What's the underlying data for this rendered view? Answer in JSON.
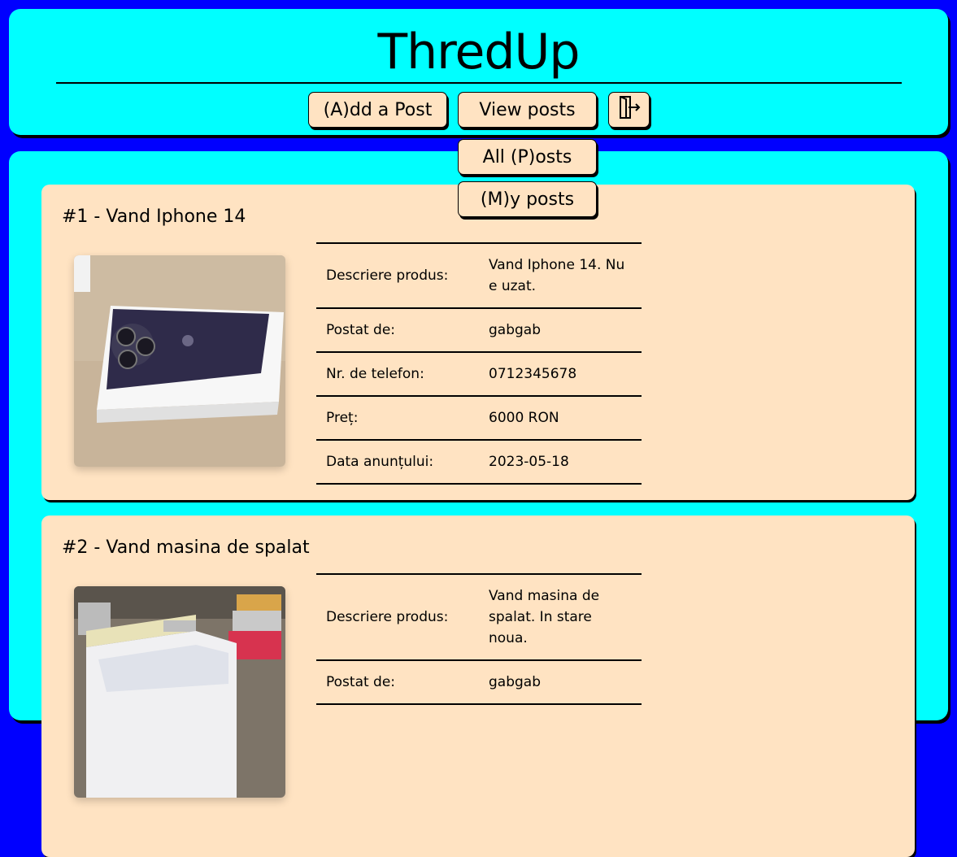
{
  "header": {
    "title": "ThredUp",
    "nav": {
      "add_post": "(A)dd a Post",
      "view_posts": "View posts",
      "logout_icon": "logout-icon"
    },
    "dropdown": {
      "all_posts": "All (P)osts",
      "my_posts": "(M)y posts"
    }
  },
  "colors": {
    "page_bg": "#0000ff",
    "panel_bg": "#00ffff",
    "card_bg": "#ffe3c2"
  },
  "posts": [
    {
      "title": "#1 - Vand Iphone 14",
      "image": "iphone-photo",
      "rows": [
        {
          "label": "Descriere produs:",
          "value": "Vand Iphone 14. Nu e uzat."
        },
        {
          "label": "Postat de:",
          "value": "gabgab"
        },
        {
          "label": "Nr. de telefon:",
          "value": "0712345678"
        },
        {
          "label": "Preț:",
          "value": "6000 RON"
        },
        {
          "label": "Data anunțului:",
          "value": "2023-05-18"
        }
      ]
    },
    {
      "title": "#2 - Vand masina de spalat",
      "image": "washing-machine-photo",
      "rows": [
        {
          "label": "Descriere produs:",
          "value": "Vand masina de spalat. In stare noua."
        },
        {
          "label": "Postat de:",
          "value": "gabgab"
        }
      ]
    }
  ]
}
